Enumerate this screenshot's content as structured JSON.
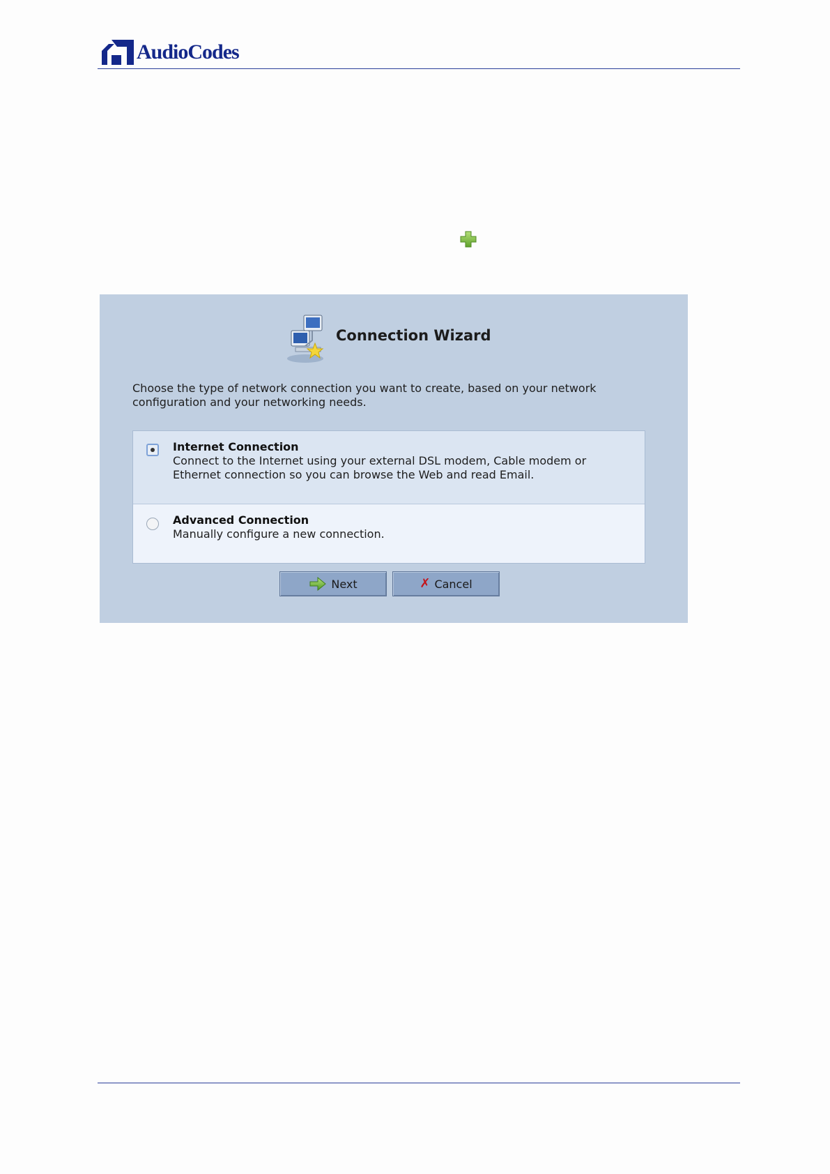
{
  "header": {
    "logo_text": "AudioCodes"
  },
  "wizard": {
    "title": "Connection Wizard",
    "description": "Choose the type of network connection you want to create, based on your network configuration and your networking needs.",
    "options": [
      {
        "title": "Internet Connection",
        "description": "Connect to the Internet using your external DSL modem, Cable modem or Ethernet connection so you can browse the Web and read Email.",
        "selected": true
      },
      {
        "title": "Advanced Connection",
        "description": "Manually configure a new connection.",
        "selected": false
      }
    ],
    "buttons": {
      "next_label": "Next",
      "cancel_label": "Cancel"
    }
  },
  "icons": [
    "audiocodes-logo-icon",
    "plus-icon",
    "connection-wizard-icon",
    "next-arrow-icon",
    "cancel-x-icon"
  ],
  "colors": {
    "brand": "#14288a",
    "rule": "#2b3f9a",
    "wizard_bg": "#c0cfe1",
    "button_bg": "#8ea6c8",
    "plus_green": "#7cc142",
    "cancel_red": "#c4141a"
  }
}
